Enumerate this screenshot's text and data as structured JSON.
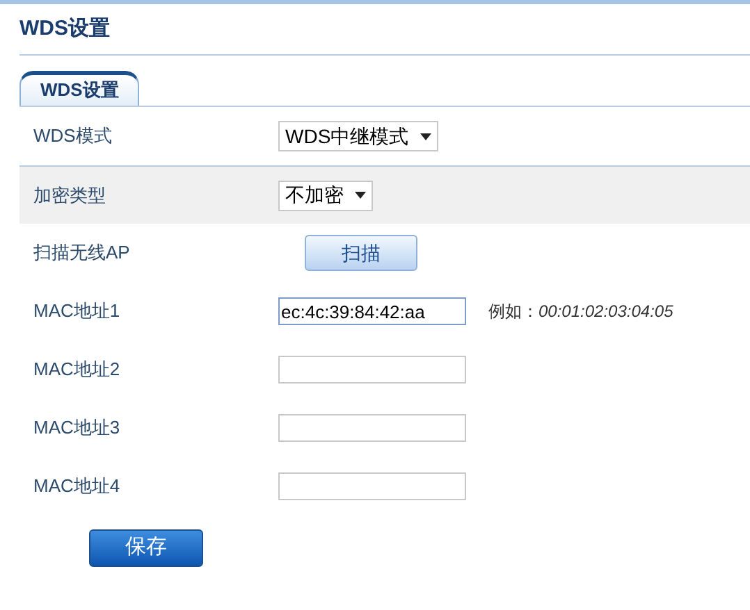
{
  "page_title": "WDS设置",
  "tabs": [
    {
      "label": "WDS设置",
      "selected": true
    }
  ],
  "rows": [
    {
      "kind": "select",
      "label": "WDS模式",
      "value": "WDS中继模式",
      "highlighted": false
    },
    {
      "kind": "select",
      "label": "加密类型",
      "value": "不加密",
      "highlighted": true
    },
    {
      "kind": "button",
      "label": "扫描无线AP",
      "value": "扫描",
      "highlighted": false
    },
    {
      "kind": "input",
      "label": "MAC地址1",
      "value": "ec:4c:39:84:42:aa",
      "focused": true,
      "hint_label": "例如：",
      "hint_example": "00:01:02:03:04:05",
      "highlighted": false
    },
    {
      "kind": "input",
      "label": "MAC地址2",
      "value": "",
      "focused": false,
      "highlighted": false
    },
    {
      "kind": "input",
      "label": "MAC地址3",
      "value": "",
      "focused": false,
      "highlighted": false
    },
    {
      "kind": "input",
      "label": "MAC地址4",
      "value": "",
      "focused": false,
      "highlighted": false
    }
  ],
  "save_button": "保存"
}
